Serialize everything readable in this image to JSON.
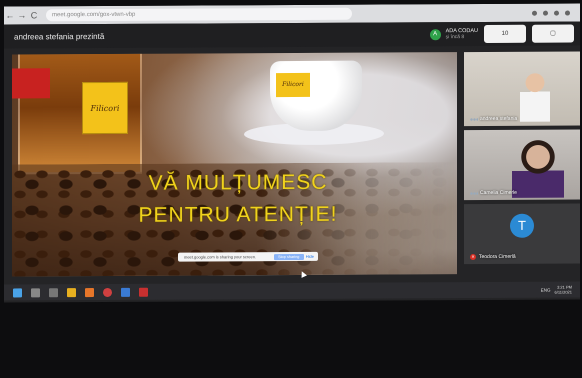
{
  "browser": {
    "url": "meet.google.com/gox-vtwn-vbp",
    "nav": [
      "←",
      "→",
      "C"
    ]
  },
  "meeting": {
    "presenter_line": "andreea stefania prezintă",
    "participant_initial": "A",
    "participant_name": "ADA CODAU",
    "participant_more": "și încă 8",
    "button_count": "10",
    "button_icon": "chat-icon"
  },
  "slide": {
    "line1": "VĂ MULȚUMESC",
    "line2": "PENTRU ATENȚIE!",
    "brand": "Filicori"
  },
  "sharebar": {
    "text": "meet.google.com is sharing your screen.",
    "stop_label": "Stop sharing",
    "hide_label": "Hide"
  },
  "tiles": [
    {
      "name": "andreea stefania"
    },
    {
      "name": "Camelia Cimerle"
    },
    {
      "name": "Teodora Cimerlă",
      "initial": "T"
    }
  ],
  "taskbar": {
    "tray": "ENG",
    "time": "3:21 PM",
    "date": "6/11/2021"
  },
  "colors": {
    "slide_text": "#f0d21c",
    "avatar_green": "#2fa24a",
    "avatar_blue": "#2b8ad4",
    "mic_red": "#d93025"
  }
}
